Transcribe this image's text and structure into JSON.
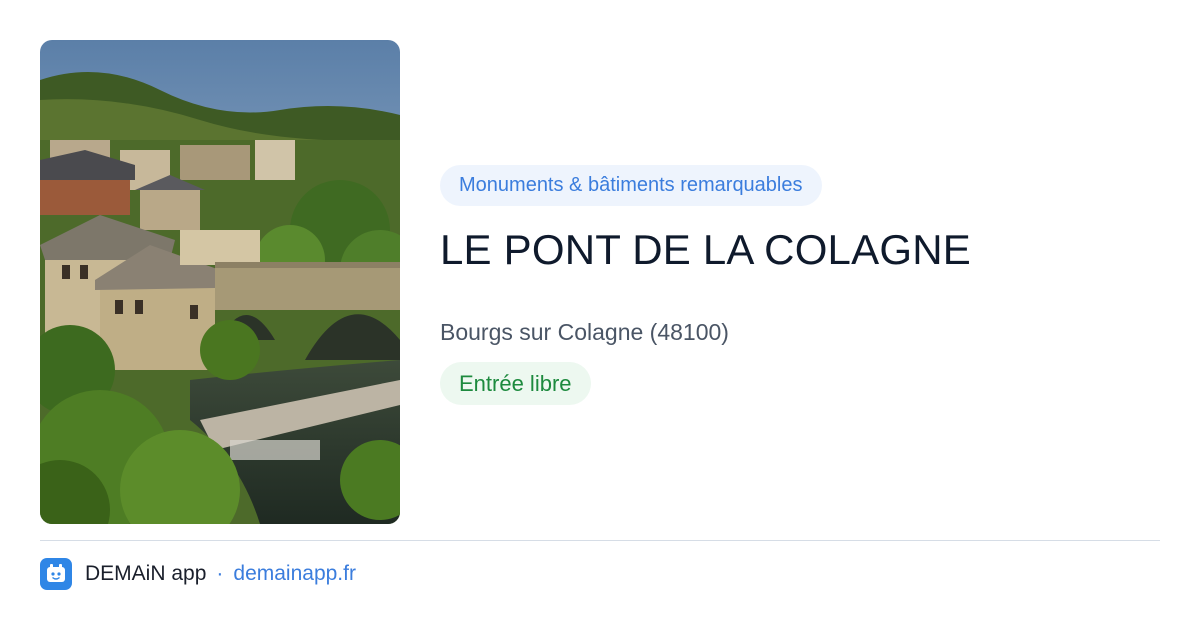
{
  "photo": {
    "icon": "landscape-photo"
  },
  "place": {
    "category": "Monuments & bâtiments remarquables",
    "name": "LE PONT DE LA COLAGNE",
    "location": "Bourgs sur Colagne (48100)",
    "entry": "Entrée libre"
  },
  "footer": {
    "brand": "DEMAiN app",
    "separator": "·",
    "site": "demainapp.fr",
    "logo_icon": "demain-app-logo-icon"
  },
  "colors": {
    "accent": "#3b7ddd",
    "category_bg": "#eef4fd",
    "entry_green": "#1d8a3e",
    "entry_bg": "#edf8f0",
    "logo_bg": "#2f86e6"
  }
}
